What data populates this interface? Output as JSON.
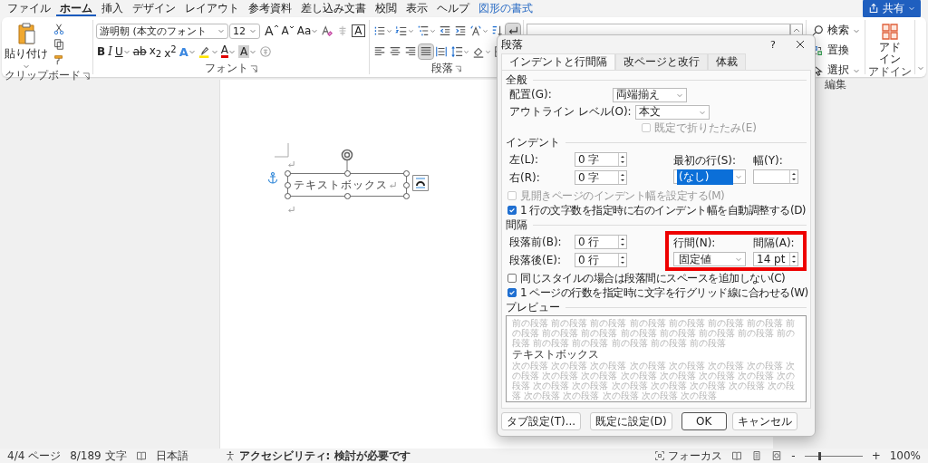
{
  "menu": {
    "tabs": [
      {
        "label": "ファイル",
        "selected": false,
        "kind": "normal"
      },
      {
        "label": "ホーム",
        "selected": true,
        "kind": "normal"
      },
      {
        "label": "挿入",
        "selected": false,
        "kind": "normal"
      },
      {
        "label": "デザイン",
        "selected": false,
        "kind": "normal"
      },
      {
        "label": "レイアウト",
        "selected": false,
        "kind": "normal"
      },
      {
        "label": "参考資料",
        "selected": false,
        "kind": "normal"
      },
      {
        "label": "差し込み文書",
        "selected": false,
        "kind": "normal"
      },
      {
        "label": "校閲",
        "selected": false,
        "kind": "normal"
      },
      {
        "label": "表示",
        "selected": false,
        "kind": "normal"
      },
      {
        "label": "ヘルプ",
        "selected": false,
        "kind": "normal"
      },
      {
        "label": "図形の書式",
        "selected": false,
        "kind": "contextual"
      }
    ],
    "share": "共有"
  },
  "ribbon": {
    "clipboard": {
      "paste": "貼り付け",
      "label": "クリップボード"
    },
    "font": {
      "name": "游明朝 (本文のフォント",
      "size": "12",
      "label": "フォント",
      "row1": [
        {
          "label": "A",
          "kind": "grow"
        },
        {
          "label": "A",
          "kind": "shrink"
        },
        {
          "label": "Aa",
          "kind": "case"
        },
        {
          "kind": "clear"
        },
        {
          "kind": "ruby"
        },
        {
          "label": "A",
          "kind": "enclosed"
        }
      ],
      "row2": [
        {
          "label": "B",
          "kind": "bold"
        },
        {
          "label": "I",
          "kind": "italic"
        },
        {
          "label": "U",
          "kind": "underline"
        },
        {
          "label": "ab",
          "kind": "strike"
        },
        {
          "label": "x$_{2}$",
          "kind": "sub"
        },
        {
          "label": "x$^{2}$",
          "kind": "sup"
        },
        {
          "label": "A",
          "kind": "effect"
        },
        {
          "kind": "highlight"
        },
        {
          "label": "A",
          "kind": "color"
        },
        {
          "label": "A",
          "kind": "shading"
        },
        {
          "kind": "circle"
        }
      ]
    },
    "paragraph": {
      "label": "段落",
      "row1": [
        {
          "kind": "bullets",
          "on": false
        },
        {
          "kind": "numbering",
          "on": false
        },
        {
          "kind": "multilevel",
          "on": false
        },
        {
          "kind": "outdent",
          "on": false
        },
        {
          "kind": "indent",
          "on": false
        },
        {
          "kind": "asian",
          "on": false
        },
        {
          "kind": "sort",
          "on": false
        },
        {
          "kind": "marks",
          "on": true
        }
      ],
      "row2": [
        {
          "kind": "left",
          "on": false
        },
        {
          "kind": "center",
          "on": false
        },
        {
          "kind": "right",
          "on": false
        },
        {
          "kind": "justify",
          "on": true
        },
        {
          "kind": "distributed",
          "on": false
        },
        {
          "kind": "linespacing",
          "on": false
        },
        {
          "kind": "shading",
          "on": false
        },
        {
          "kind": "borders",
          "on": false
        }
      ]
    },
    "editing": {
      "label": "編集",
      "items": [
        {
          "label": "検索",
          "kind": "find"
        },
        {
          "label": "置換",
          "kind": "replace"
        },
        {
          "label": "選択",
          "kind": "select"
        }
      ]
    },
    "addins": {
      "button": "アドイン",
      "label": "アドイン"
    }
  },
  "document": {
    "textbox": "テキストボックス"
  },
  "dialog": {
    "title": "段落",
    "help": "?",
    "tabs": [
      {
        "label": "インデントと行間隔",
        "selected": true
      },
      {
        "label": "改ページと改行",
        "selected": false
      },
      {
        "label": "体裁",
        "selected": false
      }
    ],
    "general": {
      "heading": "全般",
      "alignment": {
        "label": "配置(G):",
        "value": "両端揃え"
      },
      "outline": {
        "label": "アウトライン レベル(O):",
        "value": "本文"
      },
      "collapse": {
        "label": "既定で折りたたみ(E)",
        "checked": false,
        "disabled": true
      }
    },
    "indent": {
      "heading": "インデント",
      "left": {
        "label": "左(L):",
        "value": "0 字"
      },
      "right": {
        "label": "右(R):",
        "value": "0 字"
      },
      "first_line": {
        "label": "最初の行(S):",
        "value": "(なし)",
        "selected": true
      },
      "by": {
        "label": "幅(Y):"
      },
      "highlighted": false
    },
    "indent_options": [
      {
        "label": "見開きページのインデント幅を設定する(M)",
        "checked": false,
        "disabled": true
      },
      {
        "label": "1 行の文字数を指定時に右のインデント幅を自動調整する(D)",
        "checked": true,
        "disabled": false
      }
    ],
    "spacing": {
      "heading": "間隔",
      "left": {
        "label": "段落前(B):",
        "value": "0 行"
      },
      "right": {
        "label": "段落後(E):",
        "value": "0 行"
      },
      "first_line": {
        "label": "行間(N):",
        "value": "固定値",
        "selected": false
      },
      "by": {
        "label": "間隔(A):",
        "value": "14 pt"
      },
      "highlighted": true
    },
    "spacing_options": [
      {
        "label": "同じスタイルの場合は段落間にスペースを追加しない(C)",
        "checked": false,
        "disabled": false
      },
      {
        "label": "1 ページの行数を指定時に文字を行グリッド線に合わせる(W)",
        "checked": true,
        "disabled": false
      }
    ],
    "preview": {
      "heading": "プレビュー",
      "previous": "前の段落 前の段落 前の段落 前の段落 前の段落 前の段落 前の段落 前の段落 前の段落 前の段落 前の段落 前の段落 前の段落 前の段落 前の段落 前の段落 前の段落 前の段落 前の段落 前の段落",
      "current": "テキストボックス",
      "next": "次の段落 次の段落 次の段落 次の段落 次の段落 次の段落 次の段落 次の段落 次の段落 次の段落 次の段落 次の段落 次の段落 次の段落 次の段落 次の段落 次の段落 次の段落 次の段落 次の段落 次の段落 次の段落 次の段落 次の段落 次の段落 次の段落 次の段落"
    },
    "buttons": [
      {
        "label": "タブ設定(T)...",
        "kind": "normal"
      },
      {
        "label": "既定に設定(D)",
        "kind": "normal"
      },
      {
        "label": "OK",
        "kind": "default"
      },
      {
        "label": "キャンセル",
        "kind": "normal"
      }
    ]
  },
  "status_bar": {
    "page": "4/4 ページ",
    "words": "8/189 文字",
    "language": "日本語",
    "accessibility": "アクセシビリティ: 検討が必要です",
    "focus": "フォーカス",
    "zoom": {
      "minus": "-",
      "plus": "+",
      "level": 0.25,
      "value": "100%"
    }
  }
}
